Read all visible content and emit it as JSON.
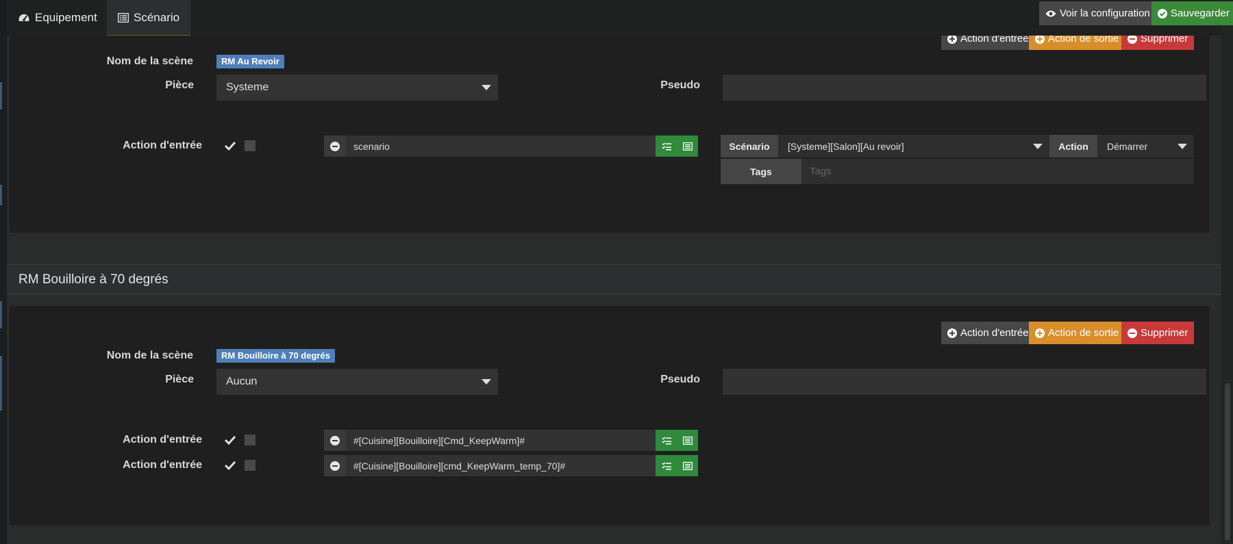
{
  "tabs": [
    {
      "label": "Equipement",
      "icon": "tachometer-icon"
    },
    {
      "label": "Scénario",
      "icon": "list-alt-icon"
    }
  ],
  "toolbar": {
    "view_config": "Voir la configuration",
    "save": "Sauvegarder"
  },
  "colors": {
    "green": "#3a8a3a",
    "orange": "#d98e2c",
    "red": "#c83a3a",
    "grey": "#474747",
    "badge_blue": "#4f7fb8"
  },
  "labels": {
    "add_entry": "Action d'entrée",
    "add_exit": "Action de sortie",
    "delete": "Supprimer",
    "scene_name": "Nom de la scène",
    "room": "Pièce",
    "pseudo": "Pseudo",
    "entry_action": "Action d'entrée"
  },
  "scene1": {
    "name": "RM Au Revoir",
    "room": "Systeme",
    "pseudo": "",
    "actions": [
      {
        "command": "scenario",
        "enabled": true,
        "checked2": false
      }
    ],
    "options": {
      "scenario_label": "Scénario",
      "scenario_value": "[Systeme][Salon][Au revoir]",
      "action_label": "Action",
      "action_value": "Démarrer",
      "tags_label": "Tags",
      "tags_placeholder": "Tags"
    }
  },
  "scene2": {
    "header": "RM Bouilloire à 70 degrés",
    "name": "RM Bouilloire à 70 degrés",
    "room": "Aucun",
    "pseudo": "",
    "actions": [
      {
        "command": "#[Cuisine][Bouilloire][Cmd_KeepWarm]#",
        "enabled": true,
        "checked2": false
      },
      {
        "command": "#[Cuisine][Bouilloire][cmd_KeepWarm_temp_70]#",
        "enabled": true,
        "checked2": false
      }
    ]
  }
}
